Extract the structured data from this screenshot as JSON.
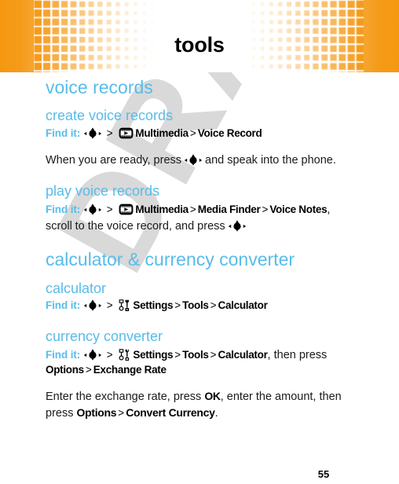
{
  "header": {
    "title": "tools",
    "accent_color": "#F59B1B"
  },
  "watermark": {
    "text": "DRAFT",
    "color": "#d9d9d9"
  },
  "theme": {
    "heading_blue": "#58BCEA",
    "body_black": "#1a1a1a"
  },
  "sections": [
    {
      "id": "voice-records",
      "heading": "voice records",
      "subsections": [
        {
          "id": "create-voice-records",
          "heading": "create voice records",
          "findit_label": "Find it:",
          "path": [
            "Multimedia",
            "Voice Record"
          ],
          "icons": [
            "nav-key-icon",
            "multimedia-icon"
          ],
          "body": "When you are ready, press   and speak into the phone.",
          "body_pre": "When you are ready, press",
          "body_post": "and speak into the phone."
        },
        {
          "id": "play-voice-records",
          "heading": "play voice records",
          "findit_label": "Find it:",
          "path": [
            "Multimedia",
            "Media Finder",
            "Voice Notes"
          ],
          "icons": [
            "nav-key-icon",
            "multimedia-icon"
          ],
          "findit_tail_1": ", scroll",
          "findit_tail_2": "to the voice record, and press"
        }
      ]
    },
    {
      "id": "calculator-currency-converter",
      "heading": "calculator & currency converter",
      "subsections": [
        {
          "id": "calculator",
          "heading": "calculator",
          "findit_label": "Find it:",
          "path": [
            "Settings",
            "Tools",
            "Calculator"
          ],
          "icons": [
            "nav-key-icon",
            "settings-icon"
          ]
        },
        {
          "id": "currency-converter",
          "heading": "currency converter",
          "findit_label": "Find it:",
          "path": [
            "Settings",
            "Tools",
            "Calculator"
          ],
          "icons": [
            "nav-key-icon",
            "settings-icon"
          ],
          "findit_tail_1": ", then press",
          "findit_tail_path": [
            "Options",
            "Exchange Rate"
          ],
          "body_pre": "Enter the exchange rate, press",
          "body_bold_1": "OK",
          "body_mid": ", enter the amount,",
          "body_line2_pre": "then press",
          "body_bold_2": "Options",
          "body_bold_3": "Convert Currency",
          "body_end": "."
        }
      ]
    }
  ],
  "footer": {
    "page_number": "55"
  }
}
